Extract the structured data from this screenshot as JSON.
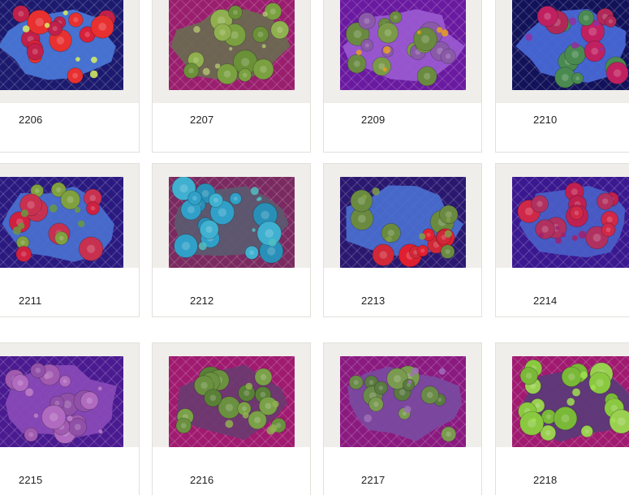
{
  "gallery": {
    "items": [
      {
        "id": "2206",
        "palette": {
          "bg": "#1c1a6e",
          "rock": "#4a78d8",
          "polyps": [
            "#d8203a",
            "#e83030",
            "#c0204a"
          ],
          "accent": "#d8f060"
        }
      },
      {
        "id": "2207",
        "palette": {
          "bg": "#9a1e6e",
          "rock": "#6a6a50",
          "polyps": [
            "#7aa040",
            "#90b050",
            "#6a9038"
          ],
          "accent": "#b0c070"
        }
      },
      {
        "id": "2209",
        "palette": {
          "bg": "#6a1aa0",
          "rock": "#9a5ad0",
          "polyps": [
            "#6a8a40",
            "#8a5aa8",
            "#7a9a48"
          ],
          "accent": "#e8a020"
        }
      },
      {
        "id": "2210",
        "palette": {
          "bg": "#12125a",
          "rock": "#4a6ad8",
          "polyps": [
            "#c02060",
            "#b02858",
            "#4a8a50"
          ],
          "accent": "#9030a0"
        }
      },
      {
        "id": "2211",
        "palette": {
          "bg": "#2a1a80",
          "rock": "#4a70d0",
          "polyps": [
            "#d02040",
            "#80a040",
            "#c83050"
          ],
          "accent": "#6a9a40"
        }
      },
      {
        "id": "2212",
        "palette": {
          "bg": "#7a2a60",
          "rock": "#5a5a70",
          "polyps": [
            "#30a0c8",
            "#40b0d0",
            "#2890b8"
          ],
          "accent": "#50c0c0"
        }
      },
      {
        "id": "2213",
        "palette": {
          "bg": "#2a1870",
          "rock": "#4a70d0",
          "polyps": [
            "#e02030",
            "#6a8a40",
            "#d02838"
          ],
          "accent": "#80a048"
        }
      },
      {
        "id": "2214",
        "palette": {
          "bg": "#3a1890",
          "rock": "#4a60c8",
          "polyps": [
            "#c02050",
            "#b03060",
            "#d02848"
          ],
          "accent": "#a02070"
        }
      },
      {
        "id": "2215",
        "palette": {
          "bg": "#4a1a90",
          "rock": "#8a4ab8",
          "polyps": [
            "#a05ab0",
            "#b06ac0",
            "#9050a8"
          ],
          "accent": "#c080c8"
        }
      },
      {
        "id": "2216",
        "palette": {
          "bg": "#a01a70",
          "rock": "#6a3a70",
          "polyps": [
            "#6a9040",
            "#7aa048",
            "#5a8038"
          ],
          "accent": "#90b050"
        }
      },
      {
        "id": "2217",
        "palette": {
          "bg": "#8a1a80",
          "rock": "#7a4aa0",
          "polyps": [
            "#6a8a48",
            "#7a9a50",
            "#5a7a40"
          ],
          "accent": "#a070b8"
        }
      },
      {
        "id": "2218",
        "palette": {
          "bg": "#a01a70",
          "rock": "#5a3a78",
          "polyps": [
            "#8ac840",
            "#9ad050",
            "#7ab838"
          ],
          "accent": "#a0e050"
        }
      }
    ]
  }
}
